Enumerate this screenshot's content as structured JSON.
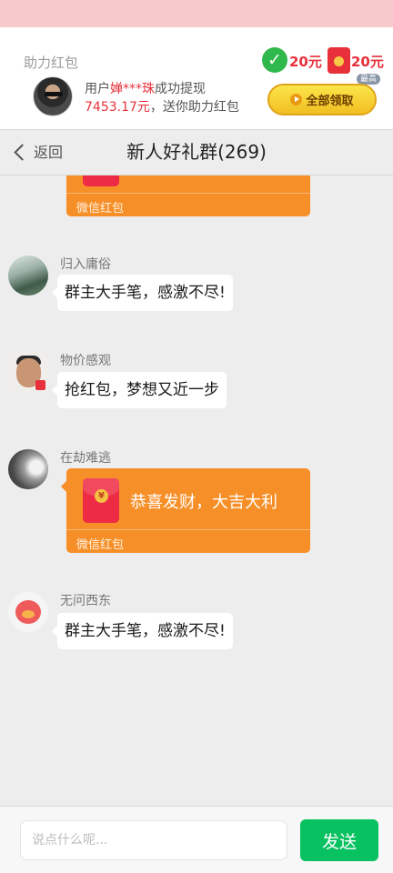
{
  "promo": {
    "title": "助力红包",
    "line1_prefix": "用户",
    "line1_name": "婵***珠",
    "line1_suffix": "成功提现",
    "line2_amount": "7453.17元",
    "line2_suffix": "，送你助力红包",
    "reward1": "20元",
    "reward2": "20元",
    "max_badge": "最高",
    "claim_label": "全部领取",
    "accent_color": "#e8303a"
  },
  "header": {
    "back_label": "返回",
    "title": "新人好礼群(269)"
  },
  "messages": [
    {
      "type": "red_packet",
      "partial": true,
      "label": "微信红包"
    },
    {
      "type": "text",
      "nickname": "归入庸俗",
      "text": "群主大手笔，感激不尽!"
    },
    {
      "type": "text",
      "nickname": "物价感观",
      "text": "抢红包，梦想又近一步"
    },
    {
      "type": "red_packet",
      "nickname": "在劫难逃",
      "text": "恭喜发财，大吉大利",
      "label": "微信红包"
    },
    {
      "type": "text",
      "nickname": "无问西东",
      "text": "群主大手笔，感激不尽!"
    }
  ],
  "input": {
    "placeholder": "说点什么呢...",
    "value": "",
    "send_label": "发送",
    "send_color": "#08c160"
  },
  "colors": {
    "packet": "#f78f28",
    "chat_bg": "#ededed"
  },
  "icons": [
    "check-icon",
    "red-envelope-icon",
    "play-icon",
    "back-chevron-icon",
    "red-packet-icon"
  ]
}
